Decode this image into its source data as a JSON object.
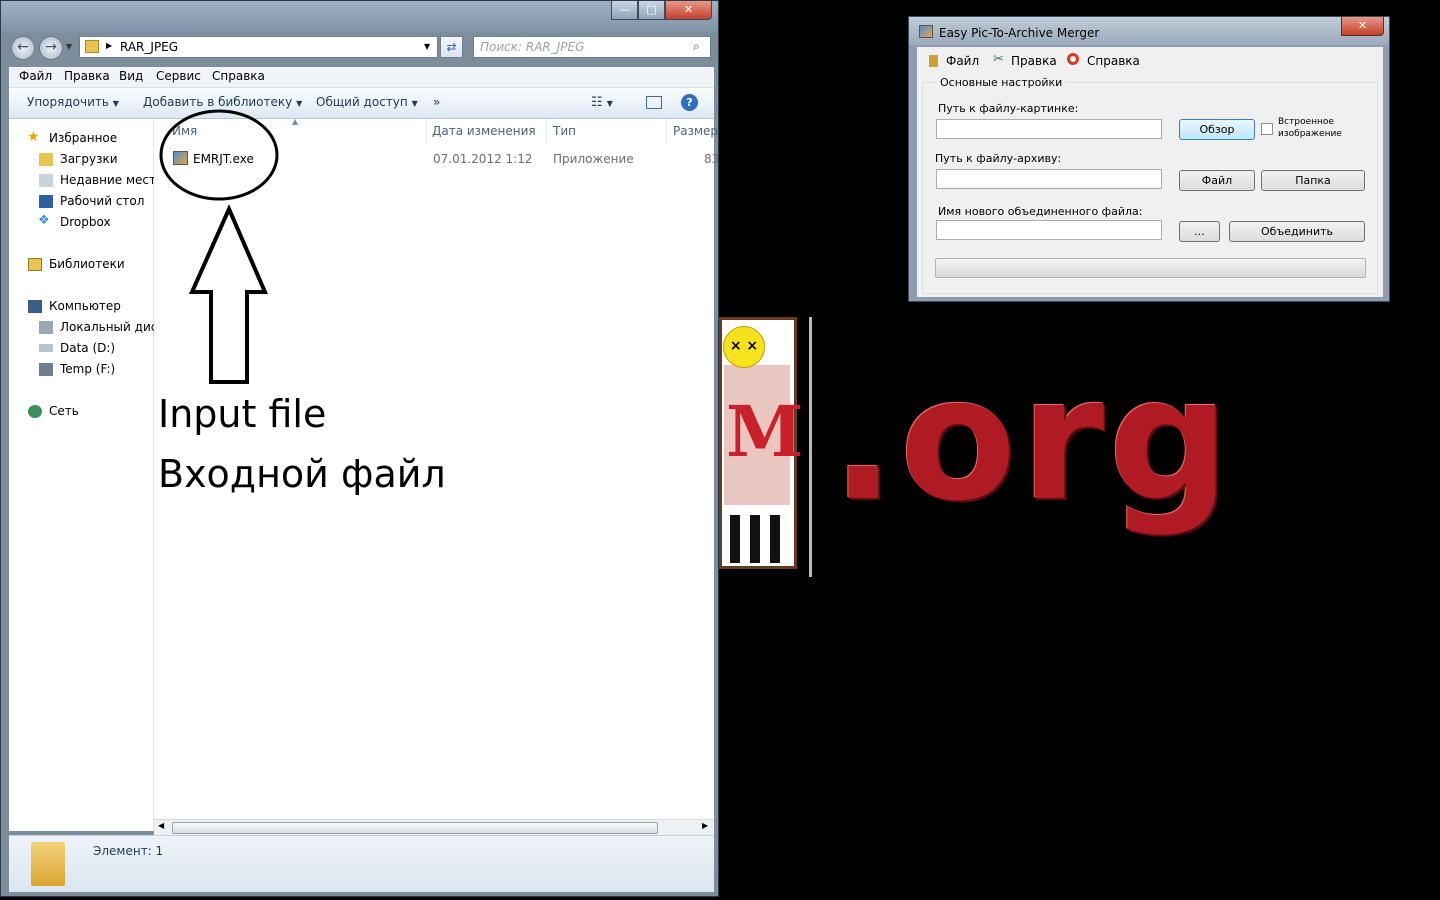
{
  "explorer": {
    "path": "RAR_JPEG",
    "search_placeholder": "Поиск: RAR_JPEG",
    "menu": [
      "Файл",
      "Правка",
      "Вид",
      "Сервис",
      "Справка"
    ],
    "commands": {
      "organize": "Упорядочить",
      "add_library": "Добавить в библиотеку",
      "share": "Общий доступ",
      "more": "»"
    },
    "nav": {
      "favorites": "Избранное",
      "downloads": "Загрузки",
      "recent": "Недавние места",
      "desktop": "Рабочий стол",
      "dropbox": "Dropbox",
      "libraries": "Библиотеки",
      "computer": "Компьютер",
      "local_disk": "Локальный диск",
      "data_d": "Data (D:)",
      "temp_f": "Temp (F:)",
      "network": "Сеть"
    },
    "columns": {
      "name": "Имя",
      "date": "Дата изменения",
      "type": "Тип",
      "size": "Размер"
    },
    "file": {
      "name": "EMRJT.exe",
      "date": "07.01.2012 1:12",
      "type": "Приложение",
      "size": "83"
    },
    "status": "Элемент: 1"
  },
  "annotation": {
    "line_en": "Input file",
    "line_ru": "Входной файл"
  },
  "merger": {
    "title": "Easy Pic-To-Archive Merger",
    "menu": {
      "file": "Файл",
      "edit": "Правка",
      "help": "Справка"
    },
    "group_label": "Основные настройки",
    "image_path_label": "Путь к файлу-картинке:",
    "browse_button": "Обзор",
    "embedded_label_1": "Встроенное",
    "embedded_label_2": "изображение",
    "archive_path_label": "Путь к файлу-архиву:",
    "file_button": "Файл",
    "folder_button": "Папка",
    "new_file_label": "Имя нового объединенного файла:",
    "dots_button": "...",
    "merge_button": "Объединить",
    "progress": 0
  },
  "background": {
    "domain_text": ".org"
  },
  "colors": {
    "desktop": "#000000",
    "explorer_frame": "#7c8d9c",
    "close_red": "#c4402a",
    "logo_red": "#b01b23"
  }
}
